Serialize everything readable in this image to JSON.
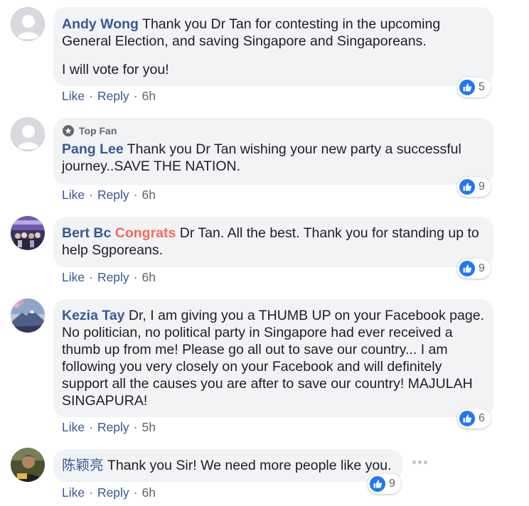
{
  "comments": [
    {
      "author": "Andy Wong",
      "text": " Thank you Dr Tan for contesting in the upcoming General Election, and saving Singapore and Singaporeans.",
      "text2": "I will vote for you!",
      "like": "Like",
      "reply": "Reply",
      "sep": "·",
      "time": "6h",
      "reactions": "5"
    },
    {
      "badge": "Top Fan",
      "author": "Pang Lee",
      "text": " Thank you Dr Tan wishing your new party a successful journey..SAVE THE NATION.",
      "like": "Like",
      "reply": "Reply",
      "sep": "·",
      "time": "6h",
      "reactions": "9"
    },
    {
      "author": "Bert Bc",
      "tag": "Congrats",
      "text": " Dr Tan. All the best. Thank you for standing up to help Sgporeans.",
      "like": "Like",
      "reply": "Reply",
      "sep": "·",
      "time": "6h",
      "reactions": "9"
    },
    {
      "author": "Kezia Tay",
      "text": " Dr, I am giving you a THUMB UP on your Facebook page. No politician, no political party in Singapore had ever received a thumb up from me! Please go all out to save our country... I am following you very closely on your Facebook and will definitely support all the causes you are after to save our country! MAJULAH SINGAPURA!",
      "like": "Like",
      "reply": "Reply",
      "sep": "·",
      "time": "5h",
      "reactions": "6"
    },
    {
      "author": "陈颖亮",
      "text": " Thank you Sir! We need more people like you.",
      "like": "Like",
      "reply": "Reply",
      "sep": "·",
      "time": "6h",
      "reactions": "9"
    }
  ],
  "colors": {
    "author": "#385898",
    "tag": "#f96a5c",
    "like_blue": "#2078f4",
    "bubble": "#f2f3f5"
  },
  "icons": {
    "reaction": "like-thumb-icon",
    "menu": "more-options-icon",
    "badge": "top-fan-star-icon"
  }
}
